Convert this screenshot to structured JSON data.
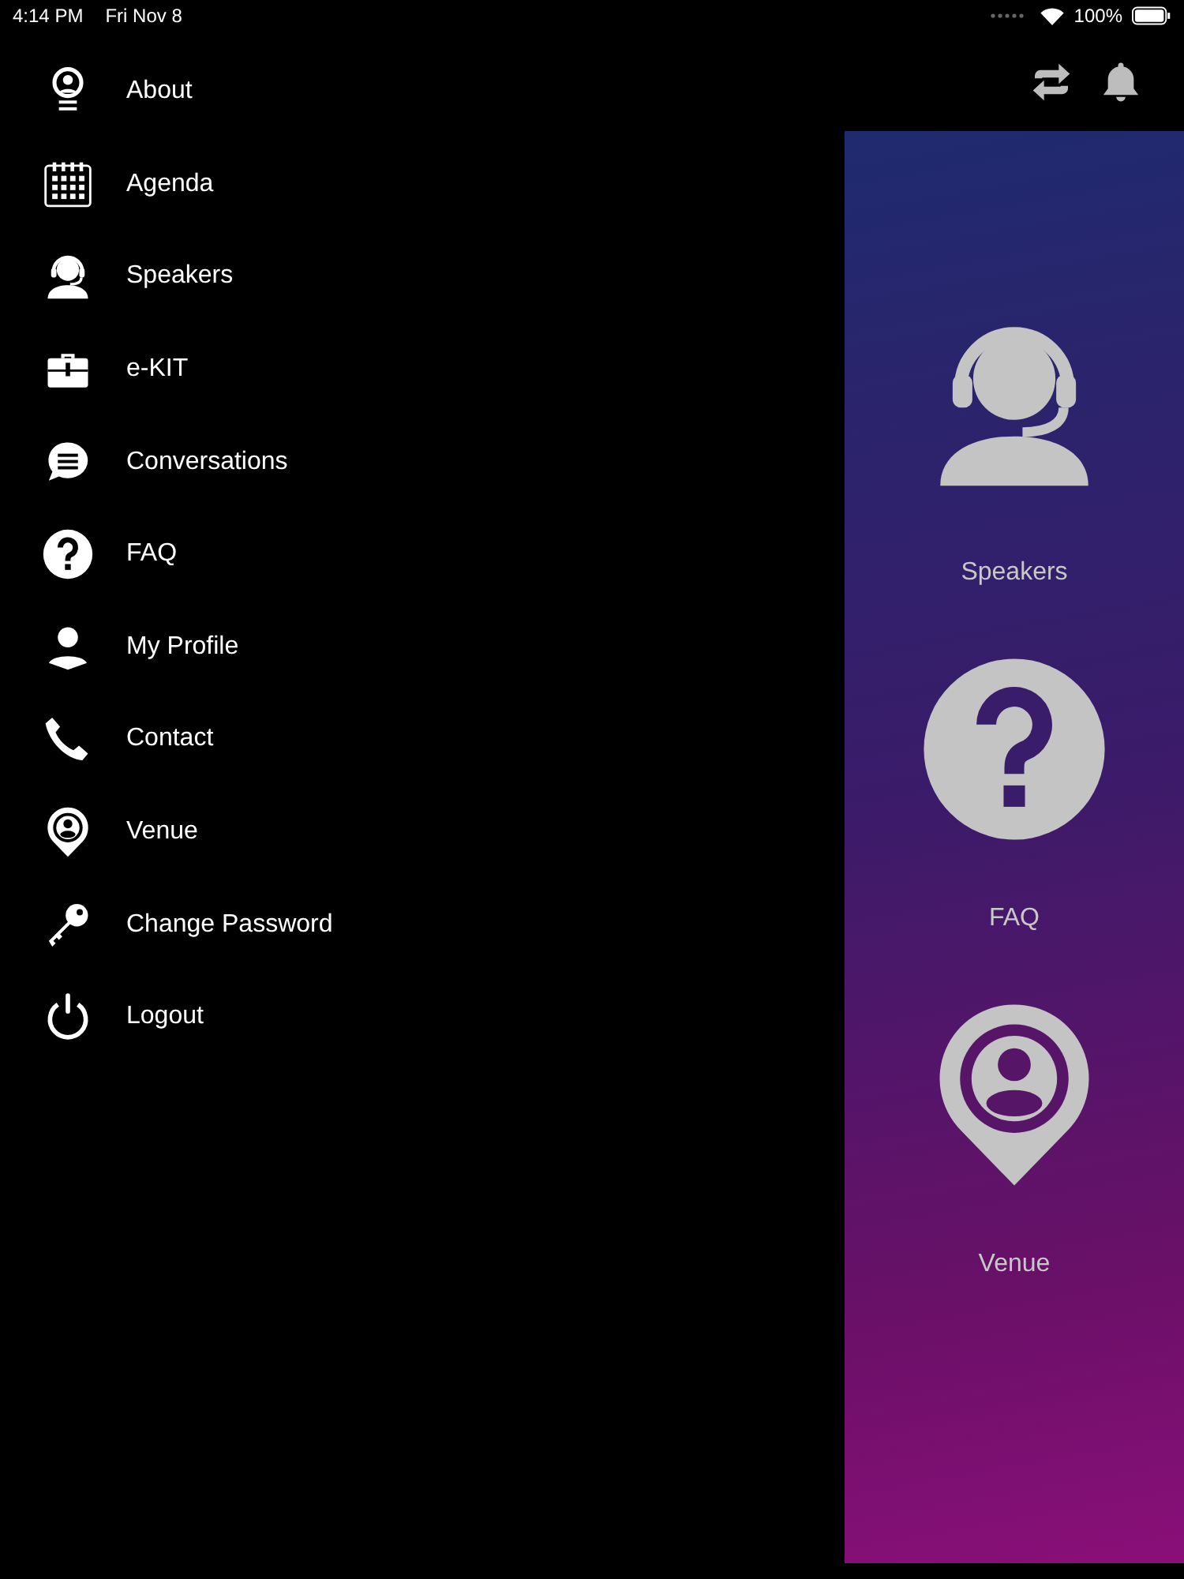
{
  "status_bar": {
    "time": "4:14 PM",
    "date": "Fri Nov 8",
    "battery": "100%"
  },
  "menu": {
    "items": [
      {
        "label": "About",
        "kind": "about"
      },
      {
        "label": "Agenda",
        "kind": "calendar"
      },
      {
        "label": "Speakers",
        "kind": "headset"
      },
      {
        "label": "e-KIT",
        "kind": "briefcase"
      },
      {
        "label": "Conversations",
        "kind": "chat"
      },
      {
        "label": "FAQ",
        "kind": "question"
      },
      {
        "label": "My Profile",
        "kind": "person"
      },
      {
        "label": "Contact",
        "kind": "phone"
      },
      {
        "label": "Venue",
        "kind": "pin"
      },
      {
        "label": "Change Password",
        "kind": "key"
      },
      {
        "label": "Logout",
        "kind": "power"
      }
    ]
  },
  "tiles": [
    {
      "label": "Speakers",
      "kind": "headset"
    },
    {
      "label": "FAQ",
      "kind": "question"
    },
    {
      "label": "Venue",
      "kind": "pin"
    }
  ]
}
